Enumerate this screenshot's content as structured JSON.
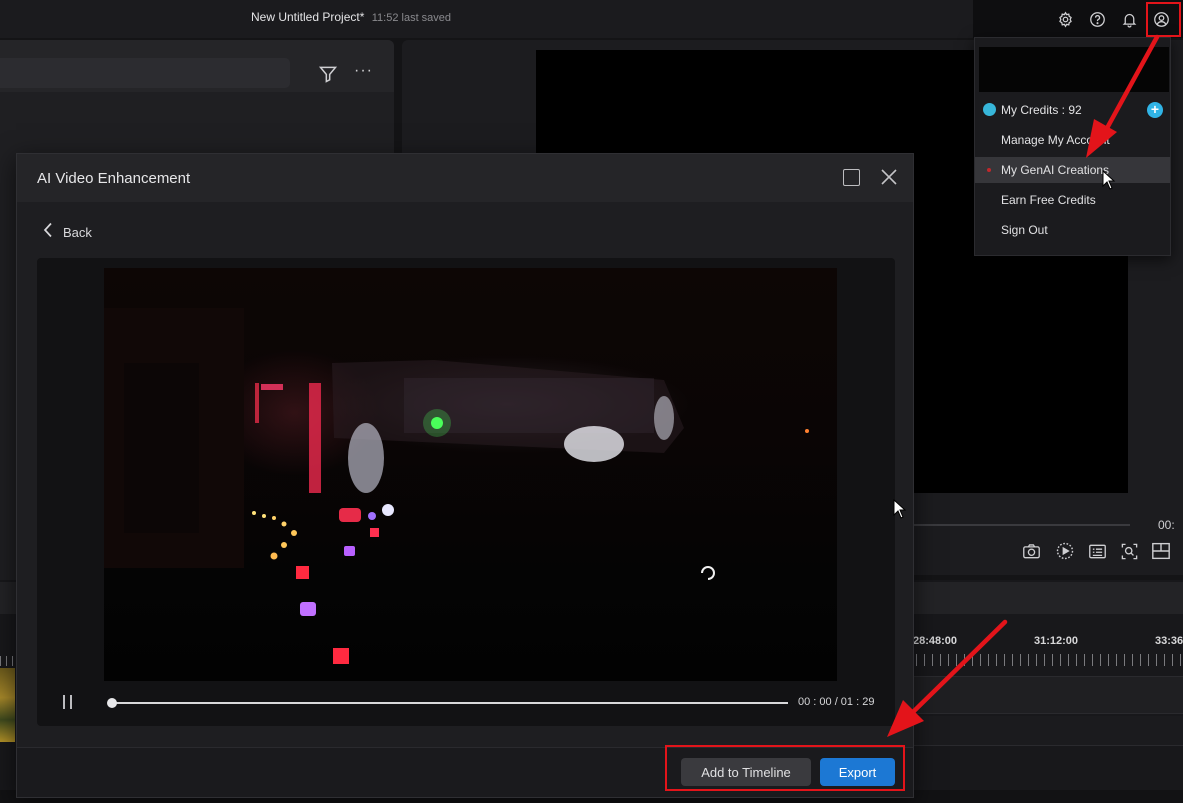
{
  "topbar": {
    "project_title": "New Untitled Project*",
    "saved_status": "11:52 last saved",
    "icons": [
      "gear-icon",
      "help-icon",
      "bell-icon",
      "account-icon"
    ]
  },
  "account_menu": {
    "credits_label": "My Credits : 92",
    "items": [
      "Manage My Account",
      "My GenAI Creations",
      "Earn Free Credits",
      "Sign Out"
    ],
    "highlighted_item": "My GenAI Creations"
  },
  "dialog": {
    "title": "AI Video Enhancement",
    "back_label": "Back",
    "time_display": "00 : 00 / 01 : 29",
    "playback_progress": 0,
    "buttons": {
      "add_to_timeline": "Add to Timeline",
      "export": "Export"
    }
  },
  "preview": {
    "time_partial": "00:"
  },
  "timeline": {
    "ruler_labels": [
      "28:48:00",
      "31:12:00",
      "33:36"
    ]
  },
  "colors": {
    "accent": "#1c78d4",
    "annotation": "#e3141a",
    "credit": "#30b4e6"
  }
}
